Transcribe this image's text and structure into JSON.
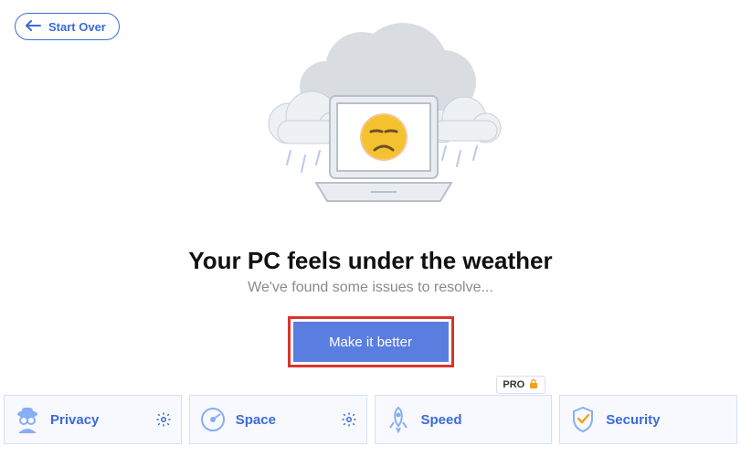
{
  "header": {
    "start_over_label": "Start Over"
  },
  "main": {
    "headline": "Your PC feels under the weather",
    "subline": "We've found some issues to resolve...",
    "cta_label": "Make it better"
  },
  "tiles": {
    "privacy": {
      "label": "Privacy",
      "has_gear": true,
      "pro": false
    },
    "space": {
      "label": "Space",
      "has_gear": true,
      "pro": false
    },
    "speed": {
      "label": "Speed",
      "has_gear": false,
      "pro": true,
      "pro_label": "PRO"
    },
    "security": {
      "label": "Security",
      "has_gear": false,
      "pro": false
    }
  },
  "colors": {
    "accent": "#3b6bdb",
    "cta_bg": "#5a7de0",
    "cta_frame": "#d9342e"
  }
}
